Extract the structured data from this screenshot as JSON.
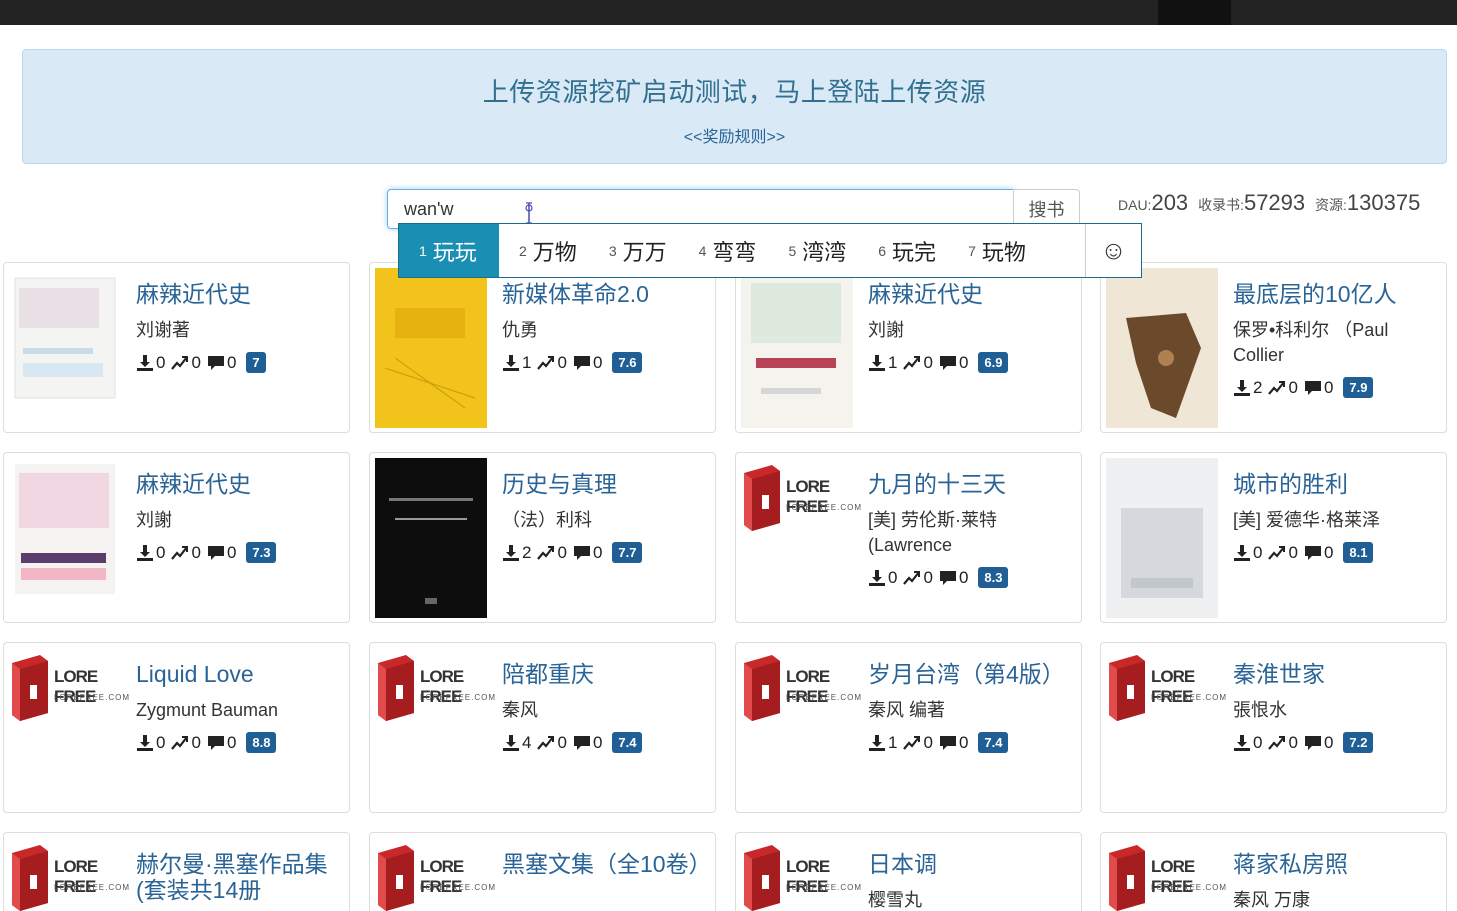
{
  "banner": {
    "headline": "上传资源挖矿启动测试，马上登陆上传资源",
    "rules_link": "<<奖励规则>>"
  },
  "search": {
    "value": "wan'w",
    "button_label": "搜书"
  },
  "ime": {
    "candidates": [
      {
        "num": "1",
        "text": "玩玩"
      },
      {
        "num": "2",
        "text": "万物"
      },
      {
        "num": "3",
        "text": "万万"
      },
      {
        "num": "4",
        "text": "弯弯"
      },
      {
        "num": "5",
        "text": "湾湾"
      },
      {
        "num": "6",
        "text": "玩完"
      },
      {
        "num": "7",
        "text": "玩物"
      }
    ],
    "emoji_icon": "☺"
  },
  "stats": {
    "dau_label": "DAU:",
    "dau_value": "203",
    "books_label": "收录书:",
    "books_value": "57293",
    "res_label": "资源:",
    "res_value": "130375"
  },
  "lorefree": {
    "title": "LORE FREE",
    "sub": "LOREFREE.COM"
  },
  "books": [
    {
      "title": "麻辣近代史",
      "author": "刘谢著",
      "downloads": "0",
      "likes": "0",
      "comments": "0",
      "score": "7",
      "cover": "mala-light"
    },
    {
      "title": "新媒体革命2.0",
      "author": "仇勇",
      "downloads": "1",
      "likes": "0",
      "comments": "0",
      "score": "7.6",
      "cover": "yellow"
    },
    {
      "title": "麻辣近代史",
      "author": "刘謝",
      "downloads": "1",
      "likes": "0",
      "comments": "0",
      "score": "6.9",
      "cover": "mala-green"
    },
    {
      "title": "最底层的10亿人",
      "author": "保罗•科利尔 （Paul Collier",
      "downloads": "2",
      "likes": "0",
      "comments": "0",
      "score": "7.9",
      "cover": "bottom-billion"
    },
    {
      "title": "麻辣近代史",
      "author": "刘謝",
      "downloads": "0",
      "likes": "0",
      "comments": "0",
      "score": "7.3",
      "cover": "mala-pink"
    },
    {
      "title": "历史与真理",
      "author": "（法）利科",
      "downloads": "2",
      "likes": "0",
      "comments": "0",
      "score": "7.7",
      "cover": "black"
    },
    {
      "title": "九月的十三天",
      "author": "[美] 劳伦斯·莱特 (Lawrence",
      "downloads": "0",
      "likes": "0",
      "comments": "0",
      "score": "8.3",
      "cover": "lorefree"
    },
    {
      "title": "城市的胜利",
      "author": "[美] 爱德华·格莱泽",
      "downloads": "0",
      "likes": "0",
      "comments": "0",
      "score": "8.1",
      "cover": "city"
    },
    {
      "title": "Liquid Love",
      "author": "Zygmunt Bauman",
      "downloads": "0",
      "likes": "0",
      "comments": "0",
      "score": "8.8",
      "cover": "lorefree"
    },
    {
      "title": "陪都重庆",
      "author": "秦风",
      "downloads": "4",
      "likes": "0",
      "comments": "0",
      "score": "7.4",
      "cover": "lorefree"
    },
    {
      "title": "岁月台湾（第4版）",
      "author": "秦风 编著",
      "downloads": "1",
      "likes": "0",
      "comments": "0",
      "score": "7.4",
      "cover": "lorefree"
    },
    {
      "title": "秦淮世家",
      "author": "張恨水",
      "downloads": "0",
      "likes": "0",
      "comments": "0",
      "score": "7.2",
      "cover": "lorefree"
    },
    {
      "title": "赫尔曼·黑塞作品集(套装共14册",
      "author": "",
      "downloads": "",
      "likes": "",
      "comments": "",
      "score": "",
      "cover": "lorefree"
    },
    {
      "title": "黑塞文集（全10卷）",
      "author": "",
      "downloads": "",
      "likes": "",
      "comments": "",
      "score": "",
      "cover": "lorefree"
    },
    {
      "title": "日本调",
      "author": "樱雪丸",
      "downloads": "",
      "likes": "",
      "comments": "",
      "score": "",
      "cover": "lorefree"
    },
    {
      "title": "蒋家私房照",
      "author": "秦风 万康",
      "downloads": "",
      "likes": "",
      "comments": "",
      "score": "",
      "cover": "lorefree"
    }
  ],
  "colors": {
    "link": "#2a6496",
    "banner_bg": "#d9eaf6",
    "score_bg": "#1f5f96",
    "ime_active": "#1b8fb3"
  }
}
